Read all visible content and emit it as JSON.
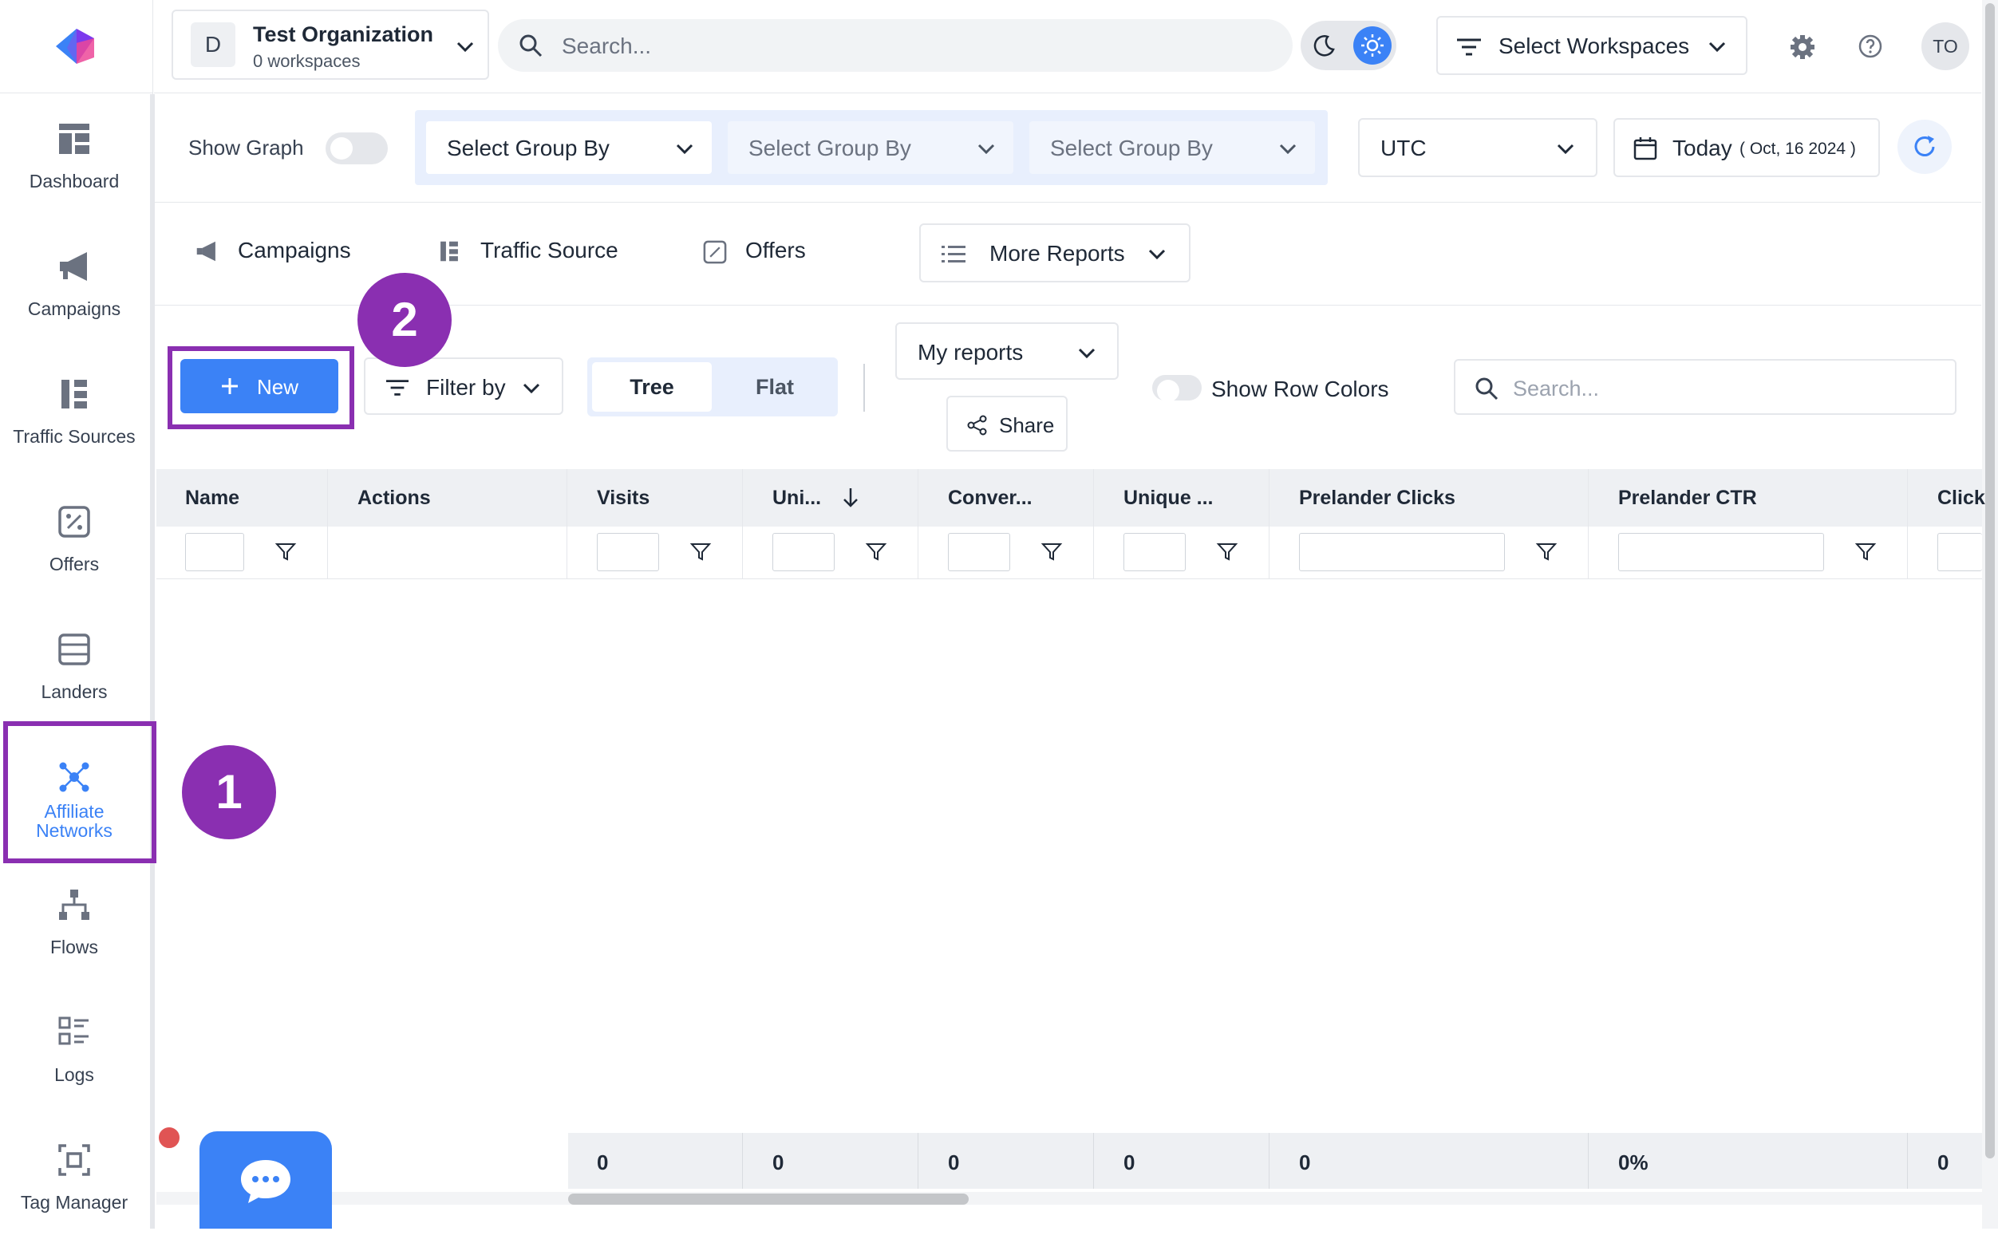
{
  "org": {
    "initial": "D",
    "name": "Test Organization",
    "subtitle": "0 workspaces"
  },
  "topbar": {
    "search_placeholder": "Search...",
    "workspaces_label": "Select Workspaces",
    "avatar_initials": "TO"
  },
  "sidebar": {
    "items": [
      {
        "label": "Dashboard",
        "icon": "dashboard-icon",
        "active": false
      },
      {
        "label": "Campaigns",
        "icon": "megaphone-icon",
        "active": false
      },
      {
        "label": "Traffic Sources",
        "icon": "traffic-sources-icon",
        "active": false
      },
      {
        "label": "Offers",
        "icon": "offers-icon",
        "active": false
      },
      {
        "label": "Landers",
        "icon": "landers-icon",
        "active": false
      },
      {
        "label": "Affiliate Networks",
        "label_line1": "Affiliate",
        "label_line2": "Networks",
        "icon": "network-icon",
        "active": true
      },
      {
        "label": "Flows",
        "icon": "flows-icon",
        "active": false
      },
      {
        "label": "Logs",
        "icon": "logs-icon",
        "active": false
      },
      {
        "label": "Tag Manager",
        "icon": "tag-manager-icon",
        "active": false
      }
    ]
  },
  "controls": {
    "show_graph_label": "Show Graph",
    "show_graph_on": false,
    "group_by": [
      "Select Group By",
      "Select Group By",
      "Select Group By"
    ],
    "timezone": "UTC",
    "date_label": "Today",
    "date_value": "( Oct, 16 2024 )"
  },
  "report_tabs": {
    "campaigns": "Campaigns",
    "traffic_source": "Traffic Source",
    "offers": "Offers",
    "more_reports": "More Reports"
  },
  "toolbar": {
    "new_label": "New",
    "filter_label": "Filter by",
    "tree_label": "Tree",
    "flat_label": "Flat",
    "my_reports_label": "My reports",
    "share_label": "Share",
    "row_colors_label": "Show Row Colors",
    "search_placeholder": "Search..."
  },
  "table": {
    "columns": [
      "Name",
      "Actions",
      "Visits",
      "Uni...",
      "Conver...",
      "Unique ...",
      "Prelander Clicks",
      "Prelander CTR",
      "Click"
    ],
    "sorted_column": "Uni...",
    "footer": [
      "0",
      "0",
      "0",
      "0",
      "0",
      "0%",
      "0"
    ]
  },
  "annotations": {
    "step1": "1",
    "step2": "2"
  },
  "colors": {
    "accent": "#3b82f6",
    "annotation": "#8a2fb1",
    "active_nav": "#3b82f6",
    "notification": "#e05454"
  }
}
